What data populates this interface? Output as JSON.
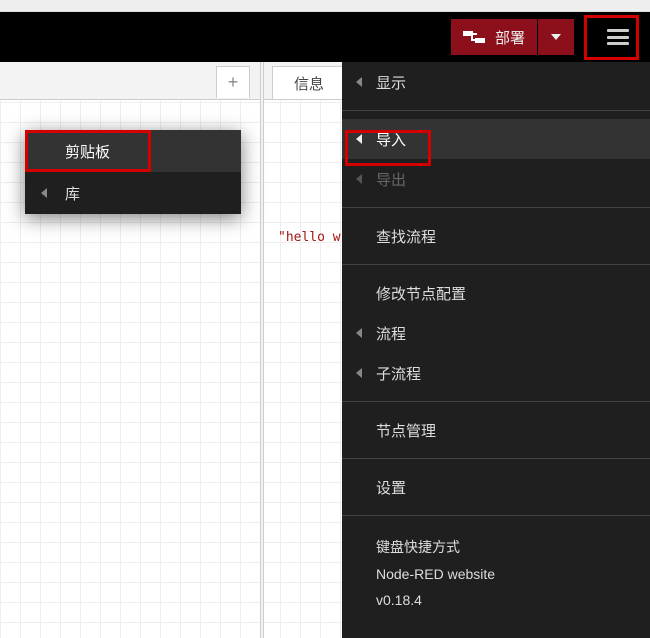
{
  "header": {
    "deploy_label": "部署"
  },
  "tabs": {
    "info_label": "信息"
  },
  "editor": {
    "snippet": "\"hello w"
  },
  "menu": {
    "show": "显示",
    "import": "导入",
    "export": "导出",
    "search_flows": "查找流程",
    "config_nodes": "修改节点配置",
    "flows": "流程",
    "subflows": "子流程",
    "manage_palette": "节点管理",
    "settings": "设置",
    "shortcuts": "键盘快捷方式",
    "website": "Node-RED website",
    "version": "v0.18.4"
  },
  "submenu": {
    "clipboard": "剪贴板",
    "library": "库"
  },
  "icons": {
    "add": "+"
  }
}
